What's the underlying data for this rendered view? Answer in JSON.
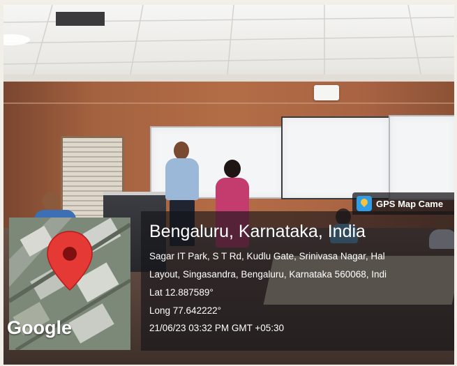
{
  "gps_tag": {
    "app_name": "GPS Map Came",
    "icon": "gps-map-camera-icon"
  },
  "location": {
    "place": "Bengaluru, Karnataka, India",
    "address_line1": "Sagar IT Park, S T Rd, Kudlu Gate, Srinivasa Nagar, Hal",
    "address_line2": "Layout, Singasandra, Bengaluru, Karnataka 560068, Indi",
    "lat": "Lat 12.887589°",
    "long": "Long 77.642222°",
    "datetime": "21/06/23 03:32 PM GMT +05:30"
  },
  "map": {
    "watermark": "Google",
    "marker_icon": "map-pin-icon",
    "pin_color": "#e53935"
  },
  "colors": {
    "overlay": "#141418",
    "wall": "#a4623f",
    "board": "#f4f5f6"
  }
}
